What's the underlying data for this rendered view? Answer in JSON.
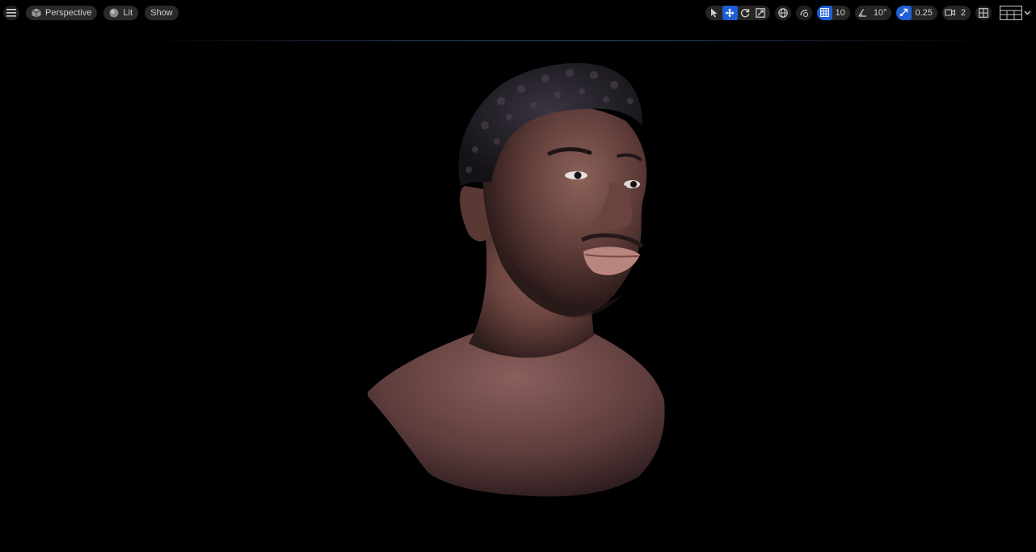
{
  "toolbar_left": {
    "menu_icon": "hamburger-icon",
    "viewport_type": {
      "label": "Perspective",
      "icon": "cube-icon"
    },
    "view_mode": {
      "label": "Lit",
      "icon": "sphere-icon"
    },
    "show": {
      "label": "Show"
    }
  },
  "toolbar_right": {
    "transform_tools": [
      "select-arrow-icon",
      "move-icon",
      "rotate-icon",
      "scale-icon"
    ],
    "active_tool": "move-icon",
    "coordinate_space_icon": "globe-icon",
    "surface_snap_icon": "surface-snap-icon",
    "grid_snap": {
      "icon": "grid-icon",
      "value": "10"
    },
    "rotation_snap": {
      "icon": "angle-icon",
      "value": "10°"
    },
    "scale_snap": {
      "icon": "scale-snap-icon",
      "value": "0.25"
    },
    "camera_speed": {
      "icon": "camera-icon",
      "value": "2"
    },
    "maximize_icon": "viewport-layout-icon",
    "layout_icon": "screen-layout-icon",
    "dropdown_icon": "chevron-down-icon"
  },
  "colors": {
    "accent": "#1f5fd6",
    "background": "#000000",
    "pill": "#2a2a2a",
    "skin": "#6e4a45",
    "hair": "#1e1b22"
  },
  "viewport": {
    "content": "3d-head-bust"
  }
}
